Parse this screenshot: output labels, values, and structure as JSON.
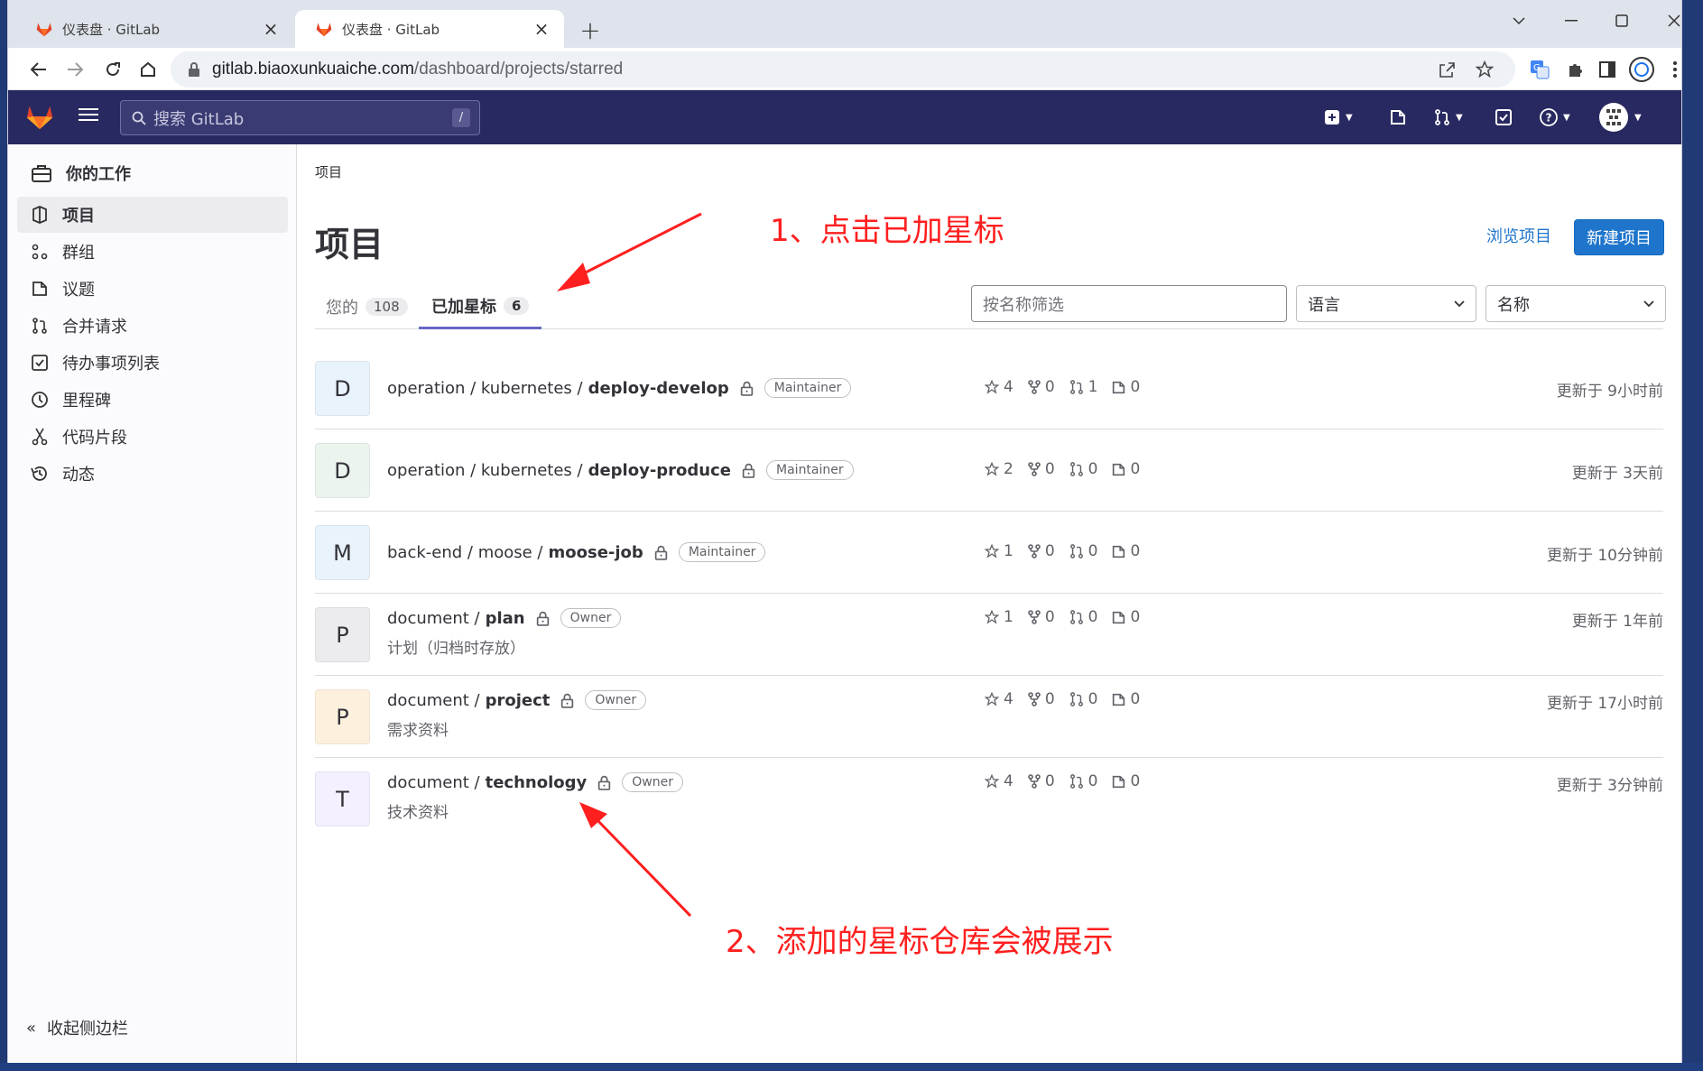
{
  "browser": {
    "tabs": [
      {
        "title": "仪表盘 · GitLab",
        "active": false
      },
      {
        "title": "仪表盘 · GitLab",
        "active": true
      }
    ],
    "url_host": "gitlab.biaoxunkuaiche.com",
    "url_path": "/dashboard/projects/starred"
  },
  "gitlab_nav": {
    "search_placeholder": "搜索 GitLab",
    "search_shortcut": "/"
  },
  "sidebar": {
    "context_title": "你的工作",
    "items": [
      {
        "label": "项目",
        "icon": "project-icon",
        "active": true
      },
      {
        "label": "群组",
        "icon": "group-icon",
        "active": false
      },
      {
        "label": "议题",
        "icon": "issues-icon",
        "active": false
      },
      {
        "label": "合并请求",
        "icon": "merge-request-icon",
        "active": false
      },
      {
        "label": "待办事项列表",
        "icon": "todo-icon",
        "active": false
      },
      {
        "label": "里程碑",
        "icon": "milestone-icon",
        "active": false
      },
      {
        "label": "代码片段",
        "icon": "snippet-icon",
        "active": false
      },
      {
        "label": "动态",
        "icon": "activity-icon",
        "active": false
      }
    ],
    "collapse_label": "收起侧边栏"
  },
  "main": {
    "breadcrumb": "项目",
    "title": "项目",
    "explore_label": "浏览项目",
    "new_project_label": "新建项目",
    "tabs": [
      {
        "label": "您的",
        "count": "108",
        "active": false
      },
      {
        "label": "已加星标",
        "count": "6",
        "active": true
      }
    ],
    "filter_placeholder": "按名称筛选",
    "language_select": "语言",
    "sort_select": "名称"
  },
  "projects": [
    {
      "avatar": "D",
      "avatar_color": "#e9f3fc",
      "namespace": "operation / kubernetes /",
      "name": "deploy-develop",
      "role": "Maintainer",
      "description": "",
      "stars": "4",
      "forks": "0",
      "mrs": "1",
      "issues": "0",
      "updated": "更新于 9小时前"
    },
    {
      "avatar": "D",
      "avatar_color": "#ecf4ee",
      "namespace": "operation / kubernetes /",
      "name": "deploy-produce",
      "role": "Maintainer",
      "description": "",
      "stars": "2",
      "forks": "0",
      "mrs": "0",
      "issues": "0",
      "updated": "更新于 3天前"
    },
    {
      "avatar": "M",
      "avatar_color": "#e9f3fc",
      "namespace": "back-end / moose /",
      "name": "moose-job",
      "role": "Maintainer",
      "description": "",
      "stars": "1",
      "forks": "0",
      "mrs": "0",
      "issues": "0",
      "updated": "更新于 10分钟前"
    },
    {
      "avatar": "P",
      "avatar_color": "#ececef",
      "namespace": "document /",
      "name": "plan",
      "role": "Owner",
      "description": "计划（归档时存放）",
      "stars": "1",
      "forks": "0",
      "mrs": "0",
      "issues": "0",
      "updated": "更新于 1年前"
    },
    {
      "avatar": "P",
      "avatar_color": "#fdf1dd",
      "namespace": "document /",
      "name": "project",
      "role": "Owner",
      "description": "需求资料",
      "stars": "4",
      "forks": "0",
      "mrs": "0",
      "issues": "0",
      "updated": "更新于 17小时前"
    },
    {
      "avatar": "T",
      "avatar_color": "#f4f0ff",
      "namespace": "document /",
      "name": "technology",
      "role": "Owner",
      "description": "技术资料",
      "stars": "4",
      "forks": "0",
      "mrs": "0",
      "issues": "0",
      "updated": "更新于 3分钟前"
    }
  ],
  "annotations": {
    "step1": "1、点击已加星标",
    "step2": "2、添加的星标仓库会被展示"
  },
  "colors": {
    "gitlab_nav": "#292961",
    "primary_button": "#1f75cb",
    "annotation": "#ff1f1f",
    "tab_underline": "#6666c4"
  }
}
